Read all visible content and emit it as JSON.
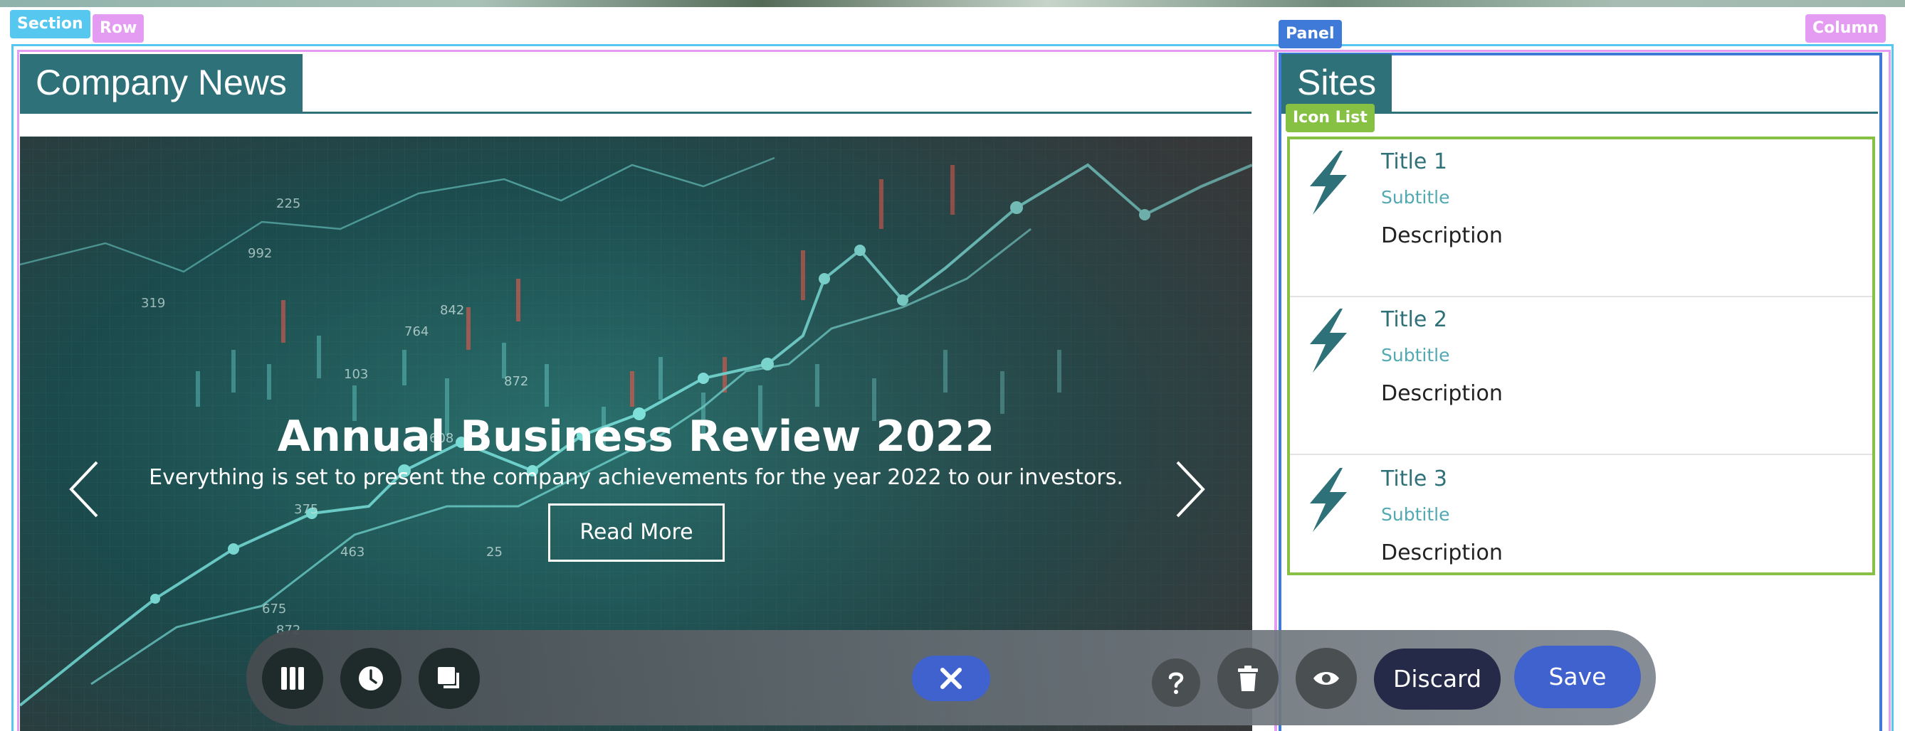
{
  "editor": {
    "tags": {
      "section": "Section",
      "row": "Row",
      "panel": "Panel",
      "column": "Column",
      "icon_list": "Icon List"
    },
    "colors": {
      "section": "#56c7ef",
      "row": "#e49bf2",
      "panel": "#3f7ad8",
      "icon_list": "#86c144"
    }
  },
  "company_news": {
    "heading": "Company News",
    "carousel": {
      "slide_title": "Annual Business Review 2022",
      "slide_text": "Everything is set to present the company achievements for the year 2022 to our investors.",
      "button_label": "Read More",
      "prev_icon": "chevron-left-icon",
      "next_icon": "chevron-right-icon"
    }
  },
  "sites": {
    "heading": "Sites",
    "items": [
      {
        "title": "Title 1",
        "subtitle": "Subtitle",
        "description": "Description",
        "icon": "lightning-icon"
      },
      {
        "title": "Title 2",
        "subtitle": "Subtitle",
        "description": "Description",
        "icon": "lightning-icon"
      },
      {
        "title": "Title 3",
        "subtitle": "Subtitle",
        "description": "Description",
        "icon": "lightning-icon"
      }
    ]
  },
  "toolbar": {
    "left_icons": [
      "columns-icon",
      "clock-icon",
      "copy-icon"
    ],
    "close_icon": "close-icon",
    "right_icons": [
      "help-icon",
      "trash-icon",
      "eye-icon"
    ],
    "discard_label": "Discard",
    "save_label": "Save",
    "accent": "#3f62cf"
  }
}
